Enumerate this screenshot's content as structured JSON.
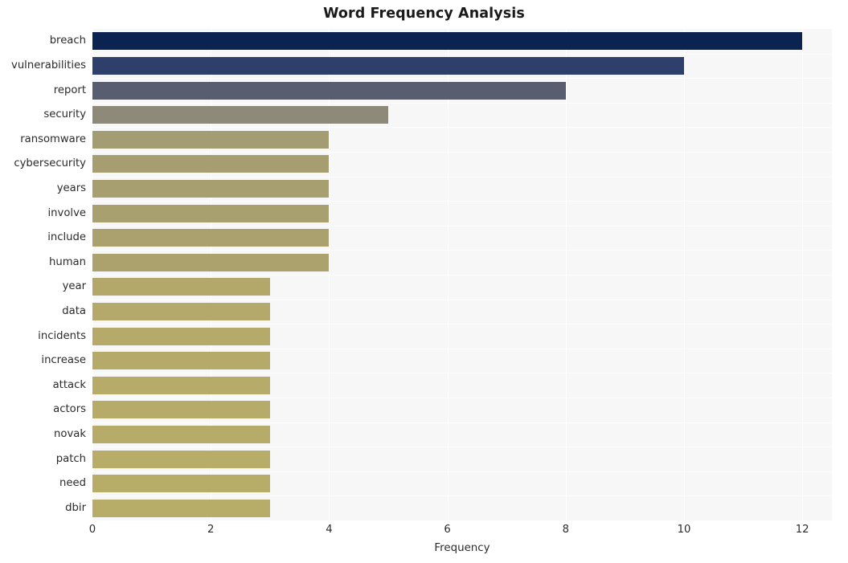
{
  "chart_data": {
    "type": "bar",
    "orientation": "horizontal",
    "title": "Word Frequency Analysis",
    "xlabel": "Frequency",
    "ylabel": "",
    "xlim": [
      0,
      12.5
    ],
    "xticks": [
      0,
      2,
      4,
      6,
      8,
      10,
      12
    ],
    "xtick_labels": [
      "0",
      "2",
      "4",
      "6",
      "8",
      "10",
      "12"
    ],
    "grid": true,
    "legend": null,
    "categories": [
      "breach",
      "vulnerabilities",
      "report",
      "security",
      "ransomware",
      "cybersecurity",
      "years",
      "involve",
      "include",
      "human",
      "year",
      "data",
      "incidents",
      "increase",
      "attack",
      "actors",
      "novak",
      "patch",
      "need",
      "dbir"
    ],
    "values": [
      12,
      10,
      8,
      5,
      4,
      4,
      4,
      4,
      4,
      4,
      3,
      3,
      3,
      3,
      3,
      3,
      3,
      3,
      3,
      3
    ],
    "bar_colors": [
      "#0a2350",
      "#2f3f6b",
      "#585d70",
      "#8e8a79",
      "#a49d73",
      "#a69e71",
      "#a89f70",
      "#a9a06f",
      "#aaa16e",
      "#aba26d",
      "#b3a86a",
      "#b4a96a",
      "#b5aa69",
      "#b5aa69",
      "#b6ab69",
      "#b6ab69",
      "#b6ab68",
      "#b7ac68",
      "#b7ac68",
      "#b7ac68"
    ],
    "plot_background": "#f7f7f8",
    "figure_background": "#ffffff",
    "gridline_color": "#ffffff",
    "title_color": "#1a1a1a",
    "tick_label_color": "#2b2b2b"
  }
}
